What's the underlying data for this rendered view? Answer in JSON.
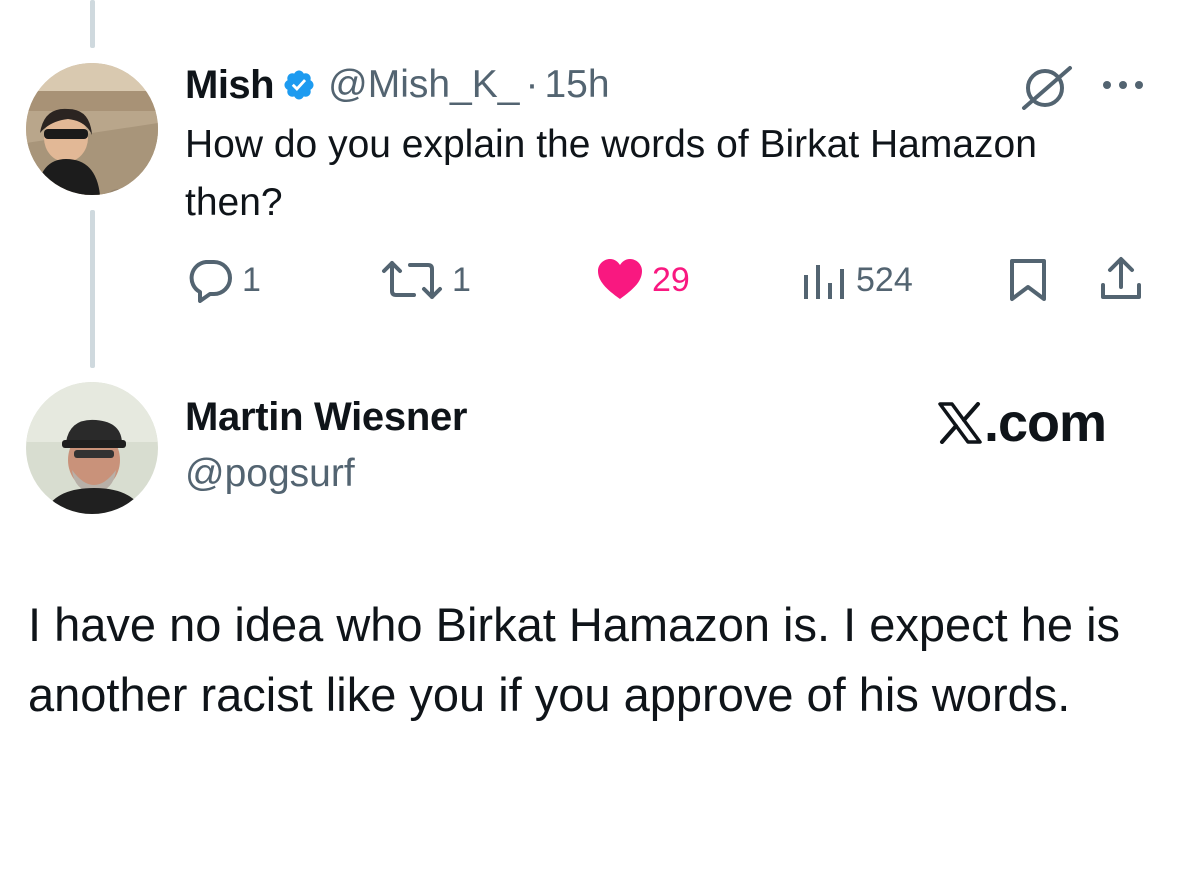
{
  "tweet1": {
    "author_name": "Mish",
    "verified": true,
    "handle": "@Mish_K_",
    "separator": "·",
    "time": "15h",
    "text": "How do you explain the words of Birkat Hamazon then?",
    "replies": "1",
    "reposts": "1",
    "likes": "29",
    "views": "524",
    "liked": true
  },
  "tweet2": {
    "author_name": "Martin Wiesner",
    "handle": "@pogsurf",
    "brand": ".com",
    "text": "I have no idea who Birkat Hamazon is. I expect he is another racist like you if you approve of his words."
  },
  "colors": {
    "verified_blue": "#1d9bf0",
    "like_pink": "#f91880",
    "secondary_text": "#536471",
    "thread_line": "#cfd9de"
  },
  "icons": [
    "verified-badge-icon",
    "grok-icon",
    "more-icon",
    "reply-icon",
    "repost-icon",
    "like-icon",
    "views-icon",
    "bookmark-icon",
    "share-icon",
    "x-logo-icon"
  ]
}
